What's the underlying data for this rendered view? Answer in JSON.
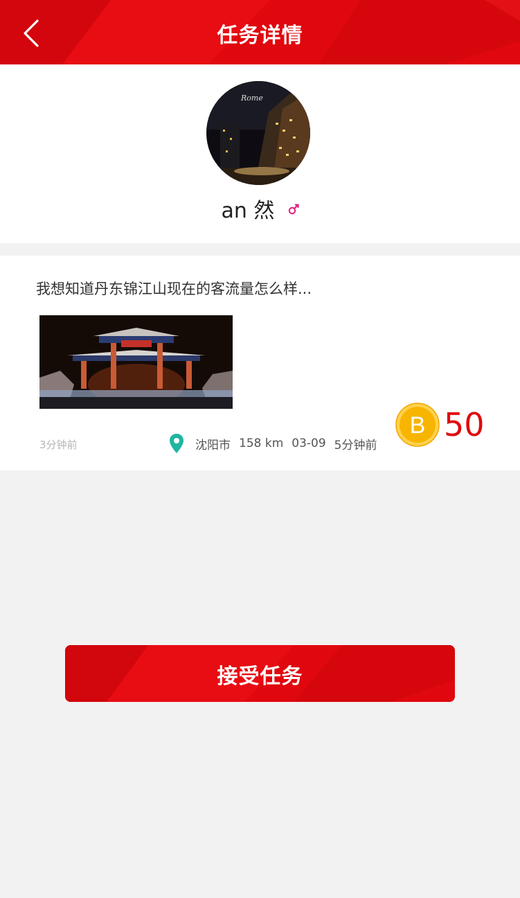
{
  "header": {
    "title": "任务详情",
    "back_icon": "chevron-left-icon"
  },
  "profile": {
    "username": "an 然",
    "gender_icon": "male-symbol-icon",
    "avatar_overlay_text": "Rome"
  },
  "task": {
    "description": "我想知道丹东锦江山现在的客流量怎么样...",
    "posted_time": "3分钟前",
    "location_icon": "map-pin-icon",
    "city": "沈阳市",
    "distance": "158 km",
    "date": "03-09",
    "time_ago": "5分钟前",
    "reward_icon": "b-coin-icon",
    "reward_letter": "B",
    "reward_amount": "50"
  },
  "actions": {
    "accept_label": "接受任务"
  },
  "colors": {
    "brand_red": "#e0080e",
    "pin_teal": "#1fb5a1",
    "coin_gold": "#f7b500",
    "gender_pink": "#e5197a",
    "background": "#f2f2f2"
  }
}
